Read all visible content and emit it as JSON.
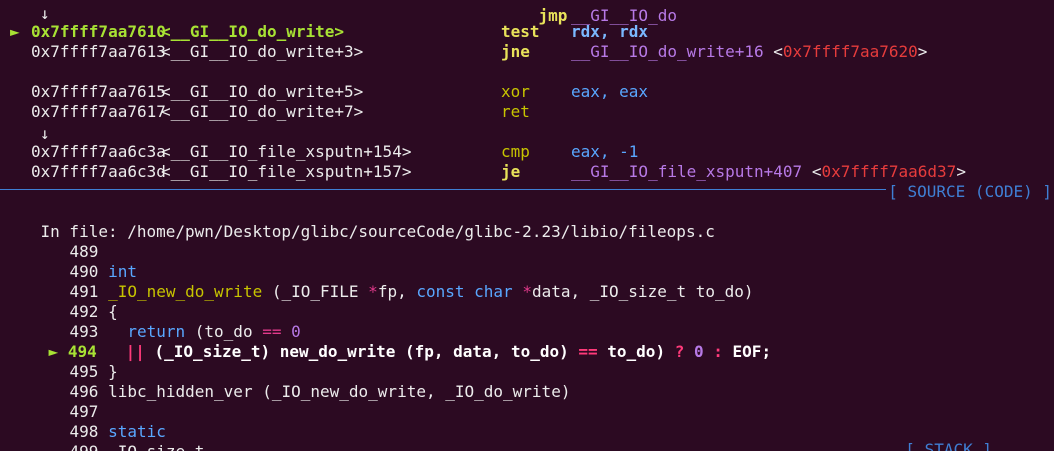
{
  "disasm": {
    "top_partial": {
      "mnem": "jmp",
      "op": "__GI__IO_do"
    },
    "arrow_down": "↓",
    "current_marker": "►",
    "rows": [
      {
        "addr": "0x7ffff7aa7610",
        "sym": "<__GI__IO_do_write>",
        "mnem": "test",
        "op": "rdx, rdx",
        "current": true
      },
      {
        "addr": "0x7ffff7aa7613",
        "sym": "<__GI__IO_do_write+3>",
        "mnem": "jne",
        "op": "__GI__IO_do_write+16",
        "target": "0x7ffff7aa7620"
      },
      {
        "addr": "0x7ffff7aa7615",
        "sym": "<__GI__IO_do_write+5>",
        "mnem": "xor",
        "op": "eax, eax"
      },
      {
        "addr": "0x7ffff7aa7617",
        "sym": "<__GI__IO_do_write+7>",
        "mnem": "ret",
        "op": ""
      },
      {
        "addr": "0x7ffff7aa6c3a",
        "sym": "<__GI__IO_file_xsputn+154>",
        "mnem": "cmp",
        "op": "eax, -1"
      },
      {
        "addr": "0x7ffff7aa6c3d",
        "sym": "<__GI__IO_file_xsputn+157>",
        "mnem": "je",
        "op": "__GI__IO_file_xsputn+407",
        "target": "0x7ffff7aa6d37"
      }
    ]
  },
  "source": {
    "section_label": "[ SOURCE (CODE) ]",
    "in_file_label": "In file:",
    "file_path": "/home/pwn/Desktop/glibc/sourceCode/glibc-2.23/libio/fileops.c",
    "lines": [
      {
        "num": "489",
        "text": ""
      },
      {
        "num": "490",
        "text": "int"
      },
      {
        "num": "491",
        "text": "_IO_new_do_write (_IO_FILE *fp, const char *data, _IO_size_t to_do)"
      },
      {
        "num": "492",
        "text": "{"
      },
      {
        "num": "493",
        "text": "  return (to_do == 0"
      },
      {
        "num": "494",
        "text": "  || (_IO_size_t) new_do_write (fp, data, to_do) == to_do) ? 0 : EOF;",
        "current": true
      },
      {
        "num": "495",
        "text": "}"
      },
      {
        "num": "496",
        "text": "libc_hidden_ver (_IO_new_do_write, _IO_do_write)"
      },
      {
        "num": "497",
        "text": ""
      },
      {
        "num": "498",
        "text": "static"
      },
      {
        "num": "499",
        "text": "_IO_size_t"
      }
    ]
  },
  "stack": {
    "section_label": "[ STACK ]"
  }
}
